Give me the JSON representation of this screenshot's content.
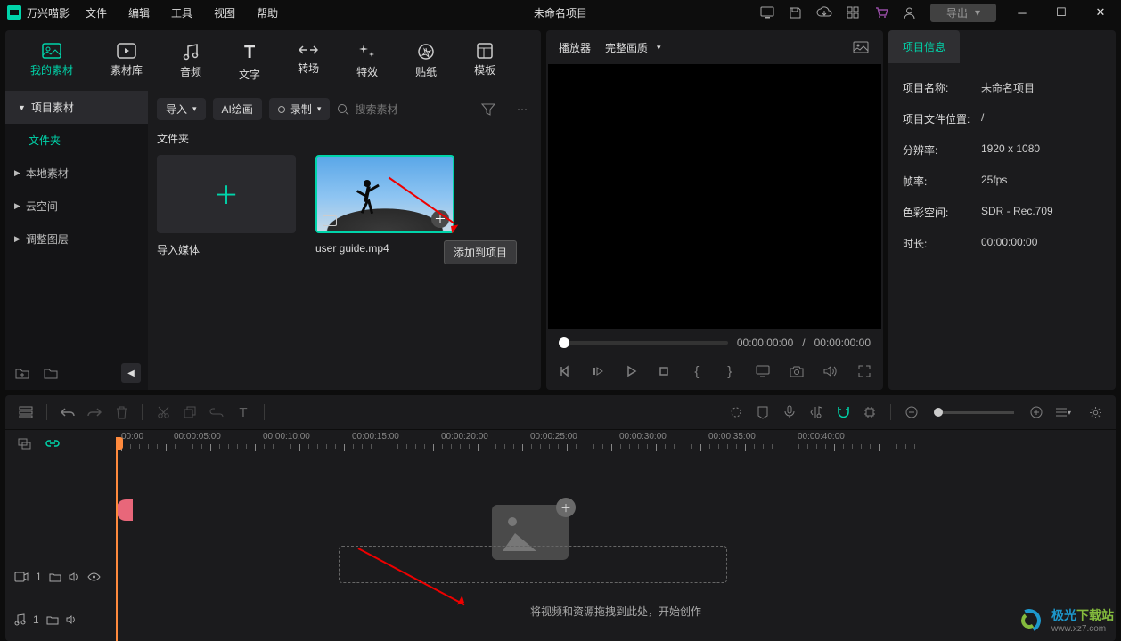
{
  "app_name": "万兴喵影",
  "menubar": [
    "文件",
    "编辑",
    "工具",
    "视图",
    "帮助"
  ],
  "window_title": "未命名项目",
  "export_label": "导出",
  "category_tabs": [
    {
      "id": "my-media",
      "label": "我的素材"
    },
    {
      "id": "stock",
      "label": "素材库"
    },
    {
      "id": "audio",
      "label": "音频"
    },
    {
      "id": "text",
      "label": "文字"
    },
    {
      "id": "transition",
      "label": "转场"
    },
    {
      "id": "effect",
      "label": "特效"
    },
    {
      "id": "sticker",
      "label": "贴纸"
    },
    {
      "id": "template",
      "label": "模板"
    }
  ],
  "sidebar": {
    "header": "项目素材",
    "active": "文件夹",
    "items": [
      "本地素材",
      "云空间",
      "调整图层"
    ]
  },
  "content_toolbar": {
    "import": "导入",
    "ai_paint": "AI绘画",
    "record": "录制",
    "search_placeholder": "搜索素材"
  },
  "section_label": "文件夹",
  "cards": {
    "import_media": "导入媒体",
    "selected_file": "user guide.mp4",
    "add_tooltip": "添加到项目"
  },
  "player": {
    "title": "播放器",
    "quality": "完整画质",
    "cur_time": "00:00:00:00",
    "sep": "/",
    "total_time": "00:00:00:00"
  },
  "info": {
    "tab": "项目信息",
    "rows": [
      {
        "k": "项目名称:",
        "v": "未命名项目"
      },
      {
        "k": "项目文件位置:",
        "v": "/"
      },
      {
        "k": "分辨率:",
        "v": "1920 x 1080"
      },
      {
        "k": "帧率:",
        "v": "25fps"
      },
      {
        "k": "色彩空间:",
        "v": "SDR - Rec.709"
      },
      {
        "k": "时长:",
        "v": "00:00:00:00"
      }
    ]
  },
  "timeline": {
    "ruler_start": "00:00",
    "ruler": [
      "00:00:05:00",
      "00:00:10:00",
      "00:00:15:00",
      "00:00:20:00",
      "00:00:25:00",
      "00:00:30:00",
      "00:00:35:00",
      "00:00:40:00"
    ],
    "drop_hint": "将视频和资源拖拽到此处，开始创作",
    "track_video_num": "1",
    "track_audio_num": "1"
  },
  "watermark": {
    "brand1": "极光",
    "brand2": "下载站",
    "url": "www.xz7.com"
  }
}
